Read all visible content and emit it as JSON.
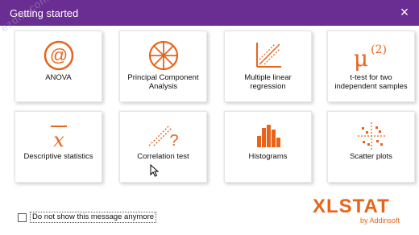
{
  "window": {
    "title": "Getting started",
    "close_icon": "×",
    "accent_color": "#6a2d91",
    "icon_color": "#e8641b"
  },
  "watermark": "ezdiw.com",
  "tiles": [
    {
      "label": "ANOVA",
      "icon": "at-sign-icon"
    },
    {
      "label": "Principal Component Analysis",
      "icon": "pca-star-icon"
    },
    {
      "label": "Multiple linear regression",
      "icon": "regression-icon"
    },
    {
      "label": "t-test for two independent samples",
      "icon": "mu-icon"
    },
    {
      "label": "Descriptive statistics",
      "icon": "x-bar-icon"
    },
    {
      "label": "Correlation test",
      "icon": "correlation-icon"
    },
    {
      "label": "Histograms",
      "icon": "histogram-icon"
    },
    {
      "label": "Scatter plots",
      "icon": "scatter-icon"
    }
  ],
  "icon_text": {
    "anova_symbol": "@",
    "mu_symbol": "μ",
    "mu_superscript": "(2)",
    "xbar_symbol": "x",
    "correlation_symbol": "?"
  },
  "footer": {
    "checkbox_label": "Do not show this message anymore",
    "checkbox_checked": false,
    "logo_main": "XLSTAT",
    "logo_sub": "by Addinsoft"
  }
}
